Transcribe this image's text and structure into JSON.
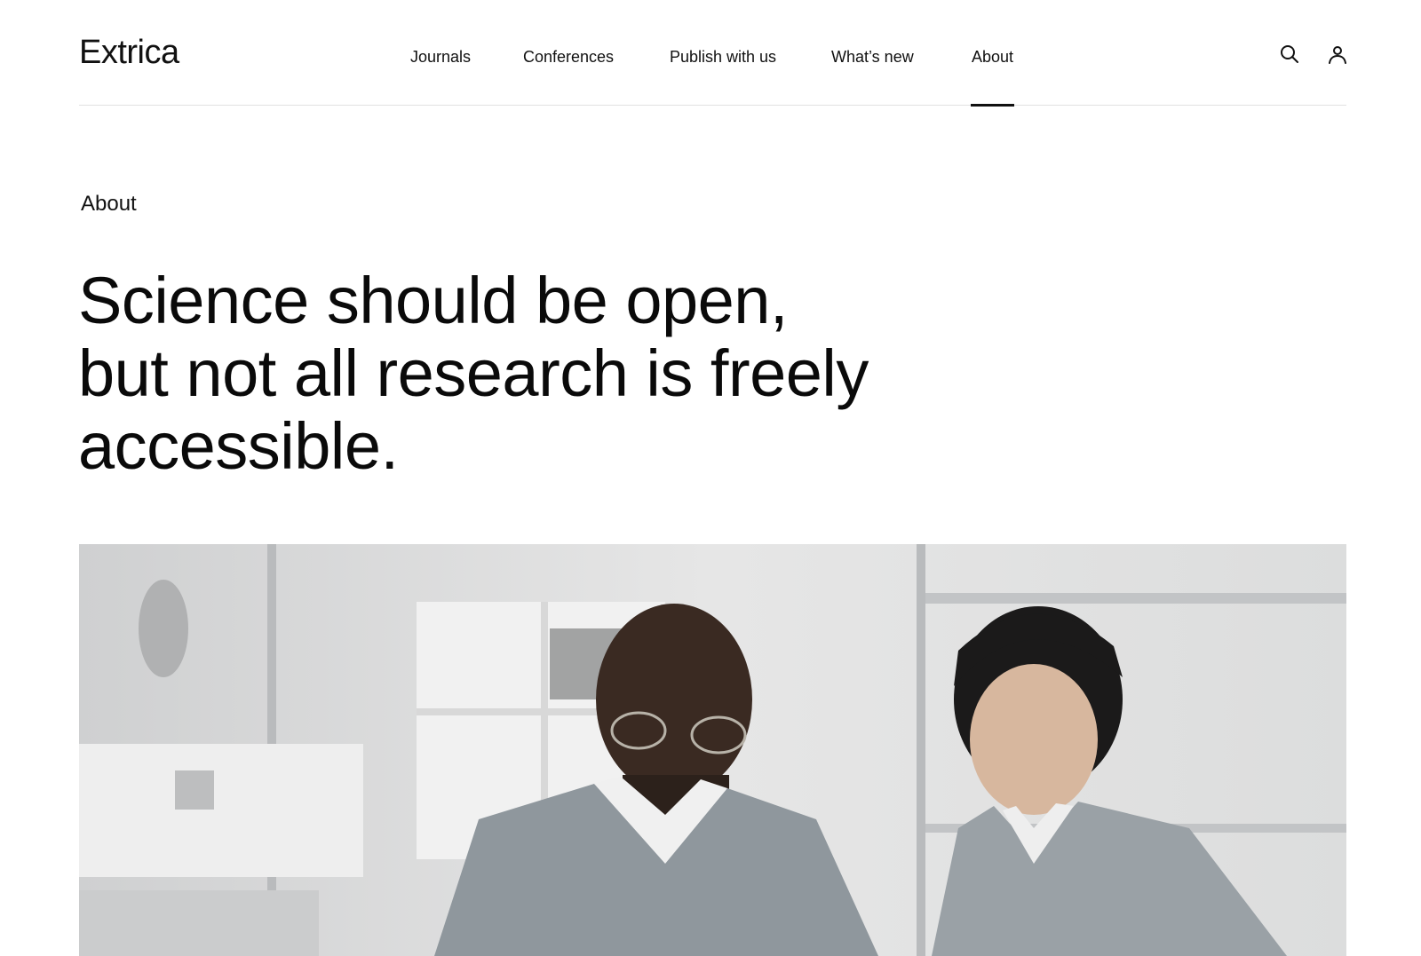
{
  "header": {
    "logo": "Extrica",
    "nav": [
      {
        "label": "Journals"
      },
      {
        "label": "Conferences"
      },
      {
        "label": "Publish with us"
      },
      {
        "label": "What’s new"
      },
      {
        "label": "About",
        "active": true
      }
    ],
    "icons": [
      "search-icon",
      "user-icon"
    ]
  },
  "main": {
    "eyebrow": "About",
    "headline_lines": [
      "Science should be open,",
      "but not all research is freely",
      "accessible."
    ]
  },
  "colors": {
    "text": "#111111",
    "divider": "#e2e2e2",
    "background": "#ffffff",
    "scrubs": "#8f979d"
  }
}
